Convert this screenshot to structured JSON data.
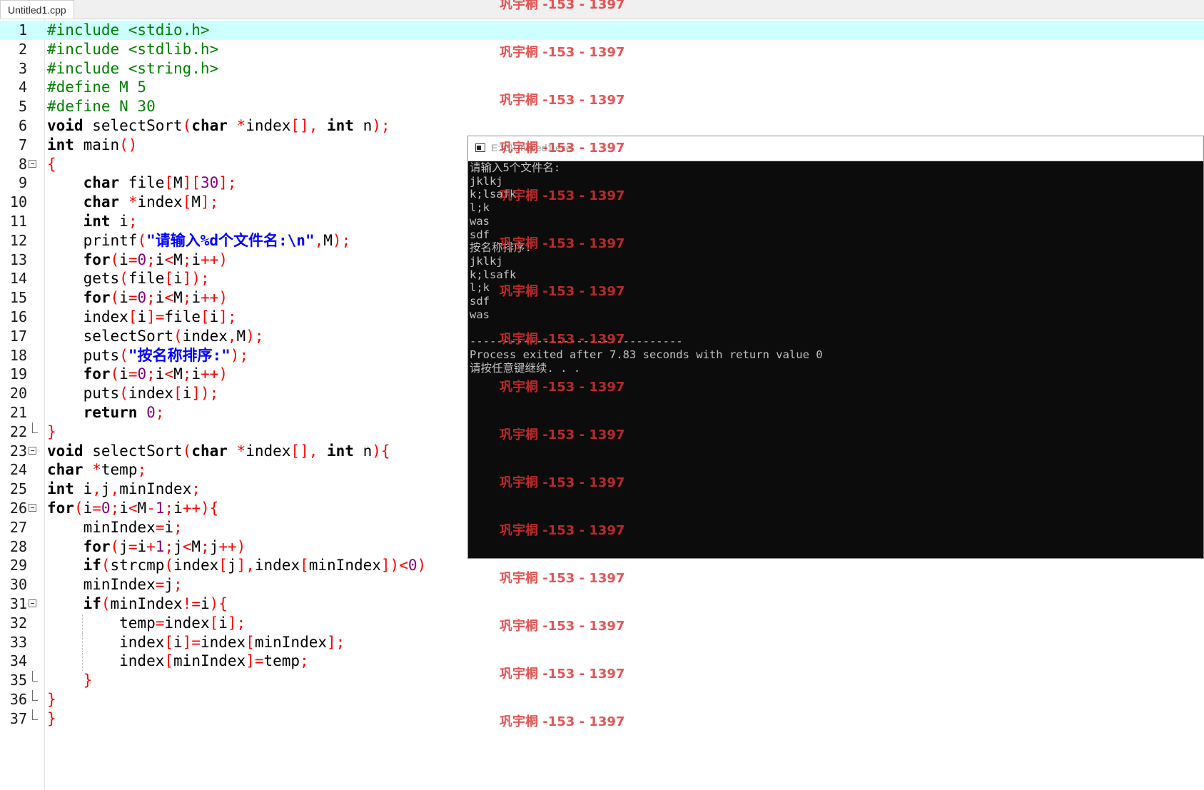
{
  "tab": {
    "label": "Untitled1.cpp"
  },
  "editor": {
    "lines": [
      {
        "n": "1",
        "tokens": [
          [
            "pp",
            "#include <stdio.h>"
          ]
        ]
      },
      {
        "n": "2",
        "tokens": [
          [
            "pp",
            "#include <stdlib.h>"
          ]
        ]
      },
      {
        "n": "3",
        "tokens": [
          [
            "pp",
            "#include <string.h>"
          ]
        ]
      },
      {
        "n": "4",
        "tokens": [
          [
            "pp",
            "#define M 5"
          ]
        ]
      },
      {
        "n": "5",
        "tokens": [
          [
            "pp",
            "#define N 30"
          ]
        ]
      },
      {
        "n": "6",
        "tokens": [
          [
            "ty",
            "void"
          ],
          [
            "tx",
            " selectSort"
          ],
          [
            "op",
            "("
          ],
          [
            "ty",
            "char"
          ],
          [
            "tx",
            " "
          ],
          [
            "op",
            "*"
          ],
          [
            "tx",
            "index"
          ],
          [
            "op",
            "[],"
          ],
          [
            "tx",
            " "
          ],
          [
            "ty",
            "int"
          ],
          [
            "tx",
            " n"
          ],
          [
            "op",
            ");"
          ]
        ]
      },
      {
        "n": "7",
        "tokens": [
          [
            "ty",
            "int"
          ],
          [
            "tx",
            " main"
          ],
          [
            "op",
            "()"
          ]
        ]
      },
      {
        "n": "8",
        "tokens": [
          [
            "br",
            "{"
          ]
        ]
      },
      {
        "n": "9",
        "tokens": [
          [
            "tx",
            "    "
          ],
          [
            "ty",
            "char"
          ],
          [
            "tx",
            " file"
          ],
          [
            "op",
            "["
          ],
          [
            "tx",
            "M"
          ],
          [
            "op",
            "]["
          ],
          [
            "nm",
            "30"
          ],
          [
            "op",
            "];"
          ]
        ]
      },
      {
        "n": "10",
        "tokens": [
          [
            "tx",
            "    "
          ],
          [
            "ty",
            "char"
          ],
          [
            "tx",
            " "
          ],
          [
            "op",
            "*"
          ],
          [
            "tx",
            "index"
          ],
          [
            "op",
            "["
          ],
          [
            "tx",
            "M"
          ],
          [
            "op",
            "];"
          ]
        ]
      },
      {
        "n": "11",
        "tokens": [
          [
            "tx",
            "    "
          ],
          [
            "ty",
            "int"
          ],
          [
            "tx",
            " i"
          ],
          [
            "op",
            ";"
          ]
        ]
      },
      {
        "n": "12",
        "tokens": [
          [
            "tx",
            "    printf"
          ],
          [
            "op",
            "("
          ],
          [
            "st",
            "\"请输入%d个文件名:\\n\""
          ],
          [
            "op",
            ","
          ],
          [
            "tx",
            "M"
          ],
          [
            "op",
            ");"
          ]
        ]
      },
      {
        "n": "13",
        "tokens": [
          [
            "tx",
            "    "
          ],
          [
            "kw",
            "for"
          ],
          [
            "op",
            "("
          ],
          [
            "tx",
            "i"
          ],
          [
            "op",
            "="
          ],
          [
            "nm",
            "0"
          ],
          [
            "op",
            ";"
          ],
          [
            "tx",
            "i"
          ],
          [
            "op",
            "<"
          ],
          [
            "tx",
            "M"
          ],
          [
            "op",
            ";"
          ],
          [
            "tx",
            "i"
          ],
          [
            "op",
            "++)"
          ]
        ]
      },
      {
        "n": "14",
        "tokens": [
          [
            "tx",
            "    gets"
          ],
          [
            "op",
            "("
          ],
          [
            "tx",
            "file"
          ],
          [
            "op",
            "["
          ],
          [
            "tx",
            "i"
          ],
          [
            "op",
            "]);"
          ]
        ]
      },
      {
        "n": "15",
        "tokens": [
          [
            "tx",
            "    "
          ],
          [
            "kw",
            "for"
          ],
          [
            "op",
            "("
          ],
          [
            "tx",
            "i"
          ],
          [
            "op",
            "="
          ],
          [
            "nm",
            "0"
          ],
          [
            "op",
            ";"
          ],
          [
            "tx",
            "i"
          ],
          [
            "op",
            "<"
          ],
          [
            "tx",
            "M"
          ],
          [
            "op",
            ";"
          ],
          [
            "tx",
            "i"
          ],
          [
            "op",
            "++)"
          ]
        ]
      },
      {
        "n": "16",
        "tokens": [
          [
            "tx",
            "    index"
          ],
          [
            "op",
            "["
          ],
          [
            "tx",
            "i"
          ],
          [
            "op",
            "]="
          ],
          [
            "tx",
            "file"
          ],
          [
            "op",
            "["
          ],
          [
            "tx",
            "i"
          ],
          [
            "op",
            "];"
          ]
        ]
      },
      {
        "n": "17",
        "tokens": [
          [
            "tx",
            "    selectSort"
          ],
          [
            "op",
            "("
          ],
          [
            "tx",
            "index"
          ],
          [
            "op",
            ","
          ],
          [
            "tx",
            "M"
          ],
          [
            "op",
            ");"
          ]
        ]
      },
      {
        "n": "18",
        "tokens": [
          [
            "tx",
            "    puts"
          ],
          [
            "op",
            "("
          ],
          [
            "st",
            "\"按名称排序:\""
          ],
          [
            "op",
            ");"
          ]
        ]
      },
      {
        "n": "19",
        "tokens": [
          [
            "tx",
            "    "
          ],
          [
            "kw",
            "for"
          ],
          [
            "op",
            "("
          ],
          [
            "tx",
            "i"
          ],
          [
            "op",
            "="
          ],
          [
            "nm",
            "0"
          ],
          [
            "op",
            ";"
          ],
          [
            "tx",
            "i"
          ],
          [
            "op",
            "<"
          ],
          [
            "tx",
            "M"
          ],
          [
            "op",
            ";"
          ],
          [
            "tx",
            "i"
          ],
          [
            "op",
            "++)"
          ]
        ]
      },
      {
        "n": "20",
        "tokens": [
          [
            "tx",
            "    puts"
          ],
          [
            "op",
            "("
          ],
          [
            "tx",
            "index"
          ],
          [
            "op",
            "["
          ],
          [
            "tx",
            "i"
          ],
          [
            "op",
            "]);"
          ]
        ]
      },
      {
        "n": "21",
        "tokens": [
          [
            "tx",
            "    "
          ],
          [
            "kw",
            "return"
          ],
          [
            "tx",
            " "
          ],
          [
            "nm",
            "0"
          ],
          [
            "op",
            ";"
          ]
        ]
      },
      {
        "n": "22",
        "tokens": [
          [
            "br",
            "}"
          ]
        ]
      },
      {
        "n": "23",
        "tokens": [
          [
            "ty",
            "void"
          ],
          [
            "tx",
            " selectSort"
          ],
          [
            "op",
            "("
          ],
          [
            "ty",
            "char"
          ],
          [
            "tx",
            " "
          ],
          [
            "op",
            "*"
          ],
          [
            "tx",
            "index"
          ],
          [
            "op",
            "[],"
          ],
          [
            "tx",
            " "
          ],
          [
            "ty",
            "int"
          ],
          [
            "tx",
            " n"
          ],
          [
            "op",
            "){"
          ]
        ]
      },
      {
        "n": "24",
        "tokens": [
          [
            "ty",
            "char"
          ],
          [
            "tx",
            " "
          ],
          [
            "op",
            "*"
          ],
          [
            "tx",
            "temp"
          ],
          [
            "op",
            ";"
          ]
        ]
      },
      {
        "n": "25",
        "tokens": [
          [
            "ty",
            "int"
          ],
          [
            "tx",
            " i"
          ],
          [
            "op",
            ","
          ],
          [
            "tx",
            "j"
          ],
          [
            "op",
            ","
          ],
          [
            "tx",
            "minIndex"
          ],
          [
            "op",
            ";"
          ]
        ]
      },
      {
        "n": "26",
        "tokens": [
          [
            "kw",
            "for"
          ],
          [
            "op",
            "("
          ],
          [
            "tx",
            "i"
          ],
          [
            "op",
            "="
          ],
          [
            "nm",
            "0"
          ],
          [
            "op",
            ";"
          ],
          [
            "tx",
            "i"
          ],
          [
            "op",
            "<"
          ],
          [
            "tx",
            "M"
          ],
          [
            "op",
            "-"
          ],
          [
            "nm",
            "1"
          ],
          [
            "op",
            ";"
          ],
          [
            "tx",
            "i"
          ],
          [
            "op",
            "++){"
          ]
        ]
      },
      {
        "n": "27",
        "tokens": [
          [
            "tx",
            "    minIndex"
          ],
          [
            "op",
            "="
          ],
          [
            "tx",
            "i"
          ],
          [
            "op",
            ";"
          ]
        ]
      },
      {
        "n": "28",
        "tokens": [
          [
            "tx",
            "    "
          ],
          [
            "kw",
            "for"
          ],
          [
            "op",
            "("
          ],
          [
            "tx",
            "j"
          ],
          [
            "op",
            "="
          ],
          [
            "tx",
            "i"
          ],
          [
            "op",
            "+"
          ],
          [
            "nm",
            "1"
          ],
          [
            "op",
            ";"
          ],
          [
            "tx",
            "j"
          ],
          [
            "op",
            "<"
          ],
          [
            "tx",
            "M"
          ],
          [
            "op",
            ";"
          ],
          [
            "tx",
            "j"
          ],
          [
            "op",
            "++)"
          ]
        ]
      },
      {
        "n": "29",
        "tokens": [
          [
            "tx",
            "    "
          ],
          [
            "kw",
            "if"
          ],
          [
            "op",
            "("
          ],
          [
            "tx",
            "strcmp"
          ],
          [
            "op",
            "("
          ],
          [
            "tx",
            "index"
          ],
          [
            "op",
            "["
          ],
          [
            "tx",
            "j"
          ],
          [
            "op",
            "],"
          ],
          [
            "tx",
            "index"
          ],
          [
            "op",
            "["
          ],
          [
            "tx",
            "minIndex"
          ],
          [
            "op",
            "])<"
          ],
          [
            "nm",
            "0"
          ],
          [
            "op",
            ")"
          ]
        ]
      },
      {
        "n": "30",
        "tokens": [
          [
            "tx",
            "    minIndex"
          ],
          [
            "op",
            "="
          ],
          [
            "tx",
            "j"
          ],
          [
            "op",
            ";"
          ]
        ]
      },
      {
        "n": "31",
        "tokens": [
          [
            "tx",
            "    "
          ],
          [
            "kw",
            "if"
          ],
          [
            "op",
            "("
          ],
          [
            "tx",
            "minIndex"
          ],
          [
            "op",
            "!="
          ],
          [
            "tx",
            "i"
          ],
          [
            "op",
            "){"
          ]
        ]
      },
      {
        "n": "32",
        "tokens": [
          [
            "tx",
            "        temp"
          ],
          [
            "op",
            "="
          ],
          [
            "tx",
            "index"
          ],
          [
            "op",
            "["
          ],
          [
            "tx",
            "i"
          ],
          [
            "op",
            "];"
          ]
        ]
      },
      {
        "n": "33",
        "tokens": [
          [
            "tx",
            "        index"
          ],
          [
            "op",
            "["
          ],
          [
            "tx",
            "i"
          ],
          [
            "op",
            "]="
          ],
          [
            "tx",
            "index"
          ],
          [
            "op",
            "["
          ],
          [
            "tx",
            "minIndex"
          ],
          [
            "op",
            "];"
          ]
        ]
      },
      {
        "n": "34",
        "tokens": [
          [
            "tx",
            "        index"
          ],
          [
            "op",
            "["
          ],
          [
            "tx",
            "minIndex"
          ],
          [
            "op",
            "]="
          ],
          [
            "tx",
            "temp"
          ],
          [
            "op",
            ";"
          ]
        ]
      },
      {
        "n": "35",
        "tokens": [
          [
            "tx",
            "    "
          ],
          [
            "br",
            "}"
          ]
        ]
      },
      {
        "n": "36",
        "tokens": [
          [
            "br",
            "}"
          ]
        ]
      },
      {
        "n": "37",
        "tokens": [
          [
            "br",
            "}"
          ]
        ]
      }
    ]
  },
  "console": {
    "title": "E:\\C\\Untitled1.exe",
    "lines": [
      "请输入5个文件名:",
      "jklkj",
      "k;lsafk",
      "l;k",
      "was",
      "sdf",
      "按名称排序:",
      "jklkj",
      "k;lsafk",
      "l;k",
      "sdf",
      "was",
      "",
      "--------------------------------",
      "Process exited after 7.83 seconds with return value 0",
      "请按任意键继续. . ."
    ]
  },
  "watermark": {
    "text": "巩宇桐 -153 - 1397"
  },
  "colors": {
    "active_line": "#ccffff",
    "preprocessor": "#008000",
    "operator": "#ff0000",
    "number": "#800080",
    "string": "#0000ff",
    "console_bg": "#0c0c0c",
    "console_fg": "#c0c0c0",
    "watermark": "#e03030"
  }
}
